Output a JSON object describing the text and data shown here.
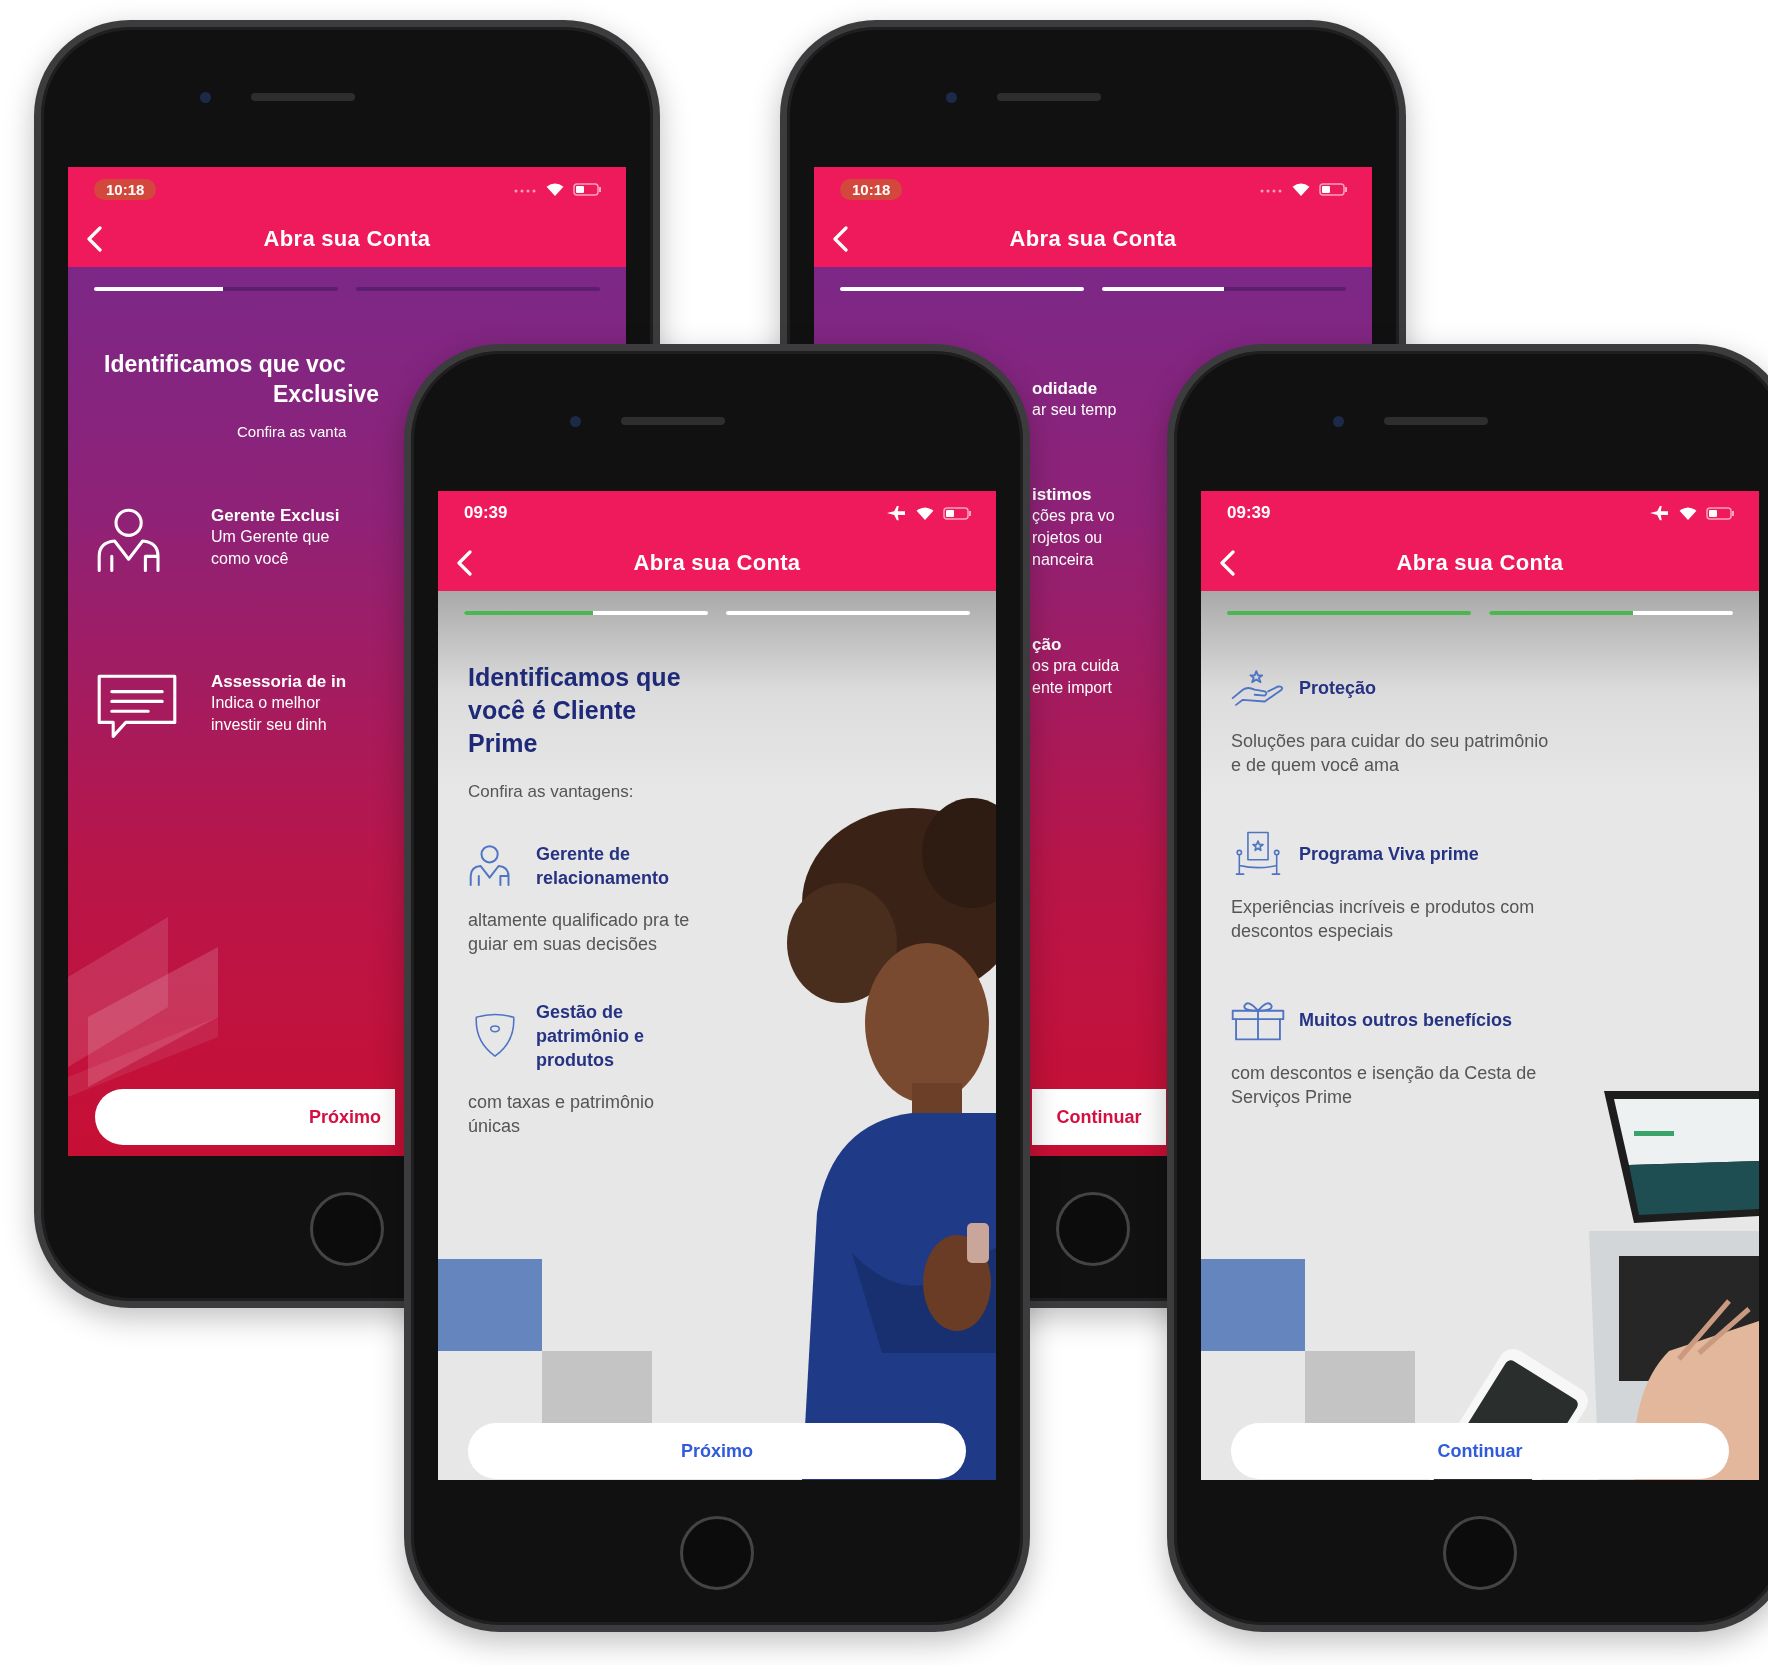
{
  "phones": [
    {
      "time": "10:18",
      "title": "Abra sua Conta",
      "progress": [
        {
          "level": 0.53
        },
        {
          "level": 0
        }
      ],
      "heading_lines": [
        "Identificamos que voc",
        "Exclusive"
      ],
      "subheading": "Confira as vanta",
      "benefits": [
        {
          "title": "Gerente Exclusi",
          "lines": [
            "Um Gerente que",
            "como você"
          ]
        },
        {
          "title": "Assessoria de in",
          "lines": [
            "Indica o melhor",
            "investir seu dinh"
          ]
        }
      ],
      "button": "Próximo"
    },
    {
      "time": "10:18",
      "title": "Abra sua Conta",
      "progress": [
        {
          "level": 1
        },
        {
          "level": 0.5
        }
      ],
      "benefits": [
        {
          "title": "odidade",
          "lines": [
            "ar seu temp"
          ]
        },
        {
          "title": "istimos",
          "lines": [
            "ções pra vo",
            "rojetos ou",
            "nanceira"
          ]
        },
        {
          "title": "ção",
          "lines": [
            "os pra cuida",
            "ente import"
          ]
        }
      ],
      "button": "Continuar"
    },
    {
      "time": "09:39",
      "title": "Abra sua Conta",
      "progress": [
        {
          "level": 0.53
        },
        {
          "level": 0
        }
      ],
      "heading": "Identificamos que você é Cliente Prime",
      "subheading": "Confira as vantagens:",
      "benefits": [
        {
          "title": "Gerente de relacionamento",
          "text": "altamente qualificado pra te guiar em suas decisões"
        },
        {
          "title": "Gestão de patrimônio e produtos",
          "text": "com taxas e patrimônio únicas"
        }
      ],
      "button": "Próximo"
    },
    {
      "time": "09:39",
      "title": "Abra sua Conta",
      "progress": [
        {
          "level": 1
        },
        {
          "level": 0.59
        }
      ],
      "benefits": [
        {
          "title": "Proteção",
          "text": "Soluções para cuidar do seu patrimônio e de quem você ama"
        },
        {
          "title": "Programa Viva prime",
          "text": "Experiências incríveis e produtos com descontos especiais"
        },
        {
          "title": "Muitos outros benefícios",
          "text": "com descontos e isenção da Cesta de Serviços Prime"
        }
      ],
      "button": "Continuar"
    }
  ]
}
